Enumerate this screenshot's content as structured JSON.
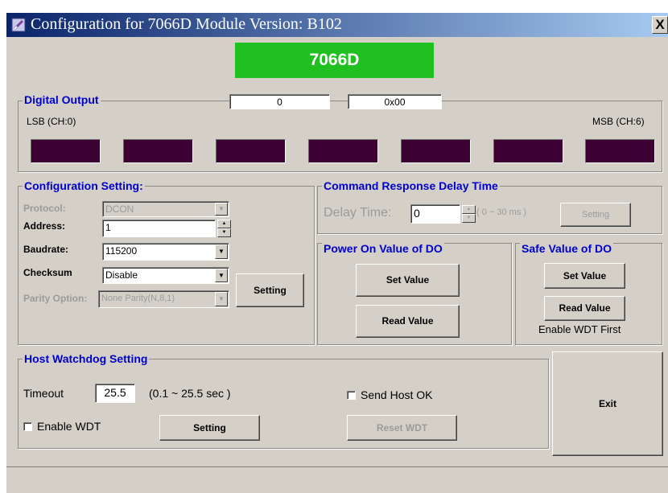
{
  "window": {
    "title": "Configuration for 7066D Module Version: B102",
    "close_label": "X"
  },
  "module_name": "7066D",
  "digital_output": {
    "legend": "Digital Output",
    "decimal_value": "0",
    "hex_value": "0x00",
    "lsb_label": "LSB (CH:0)",
    "msb_label": "MSB (CH:6)",
    "channels": 7
  },
  "config_setting": {
    "legend": "Configuration Setting:",
    "protocol_label": "Protocol:",
    "protocol_value": "DCON",
    "address_label": "Address:",
    "address_value": "1",
    "baudrate_label": "Baudrate:",
    "baudrate_value": "115200",
    "checksum_label": "Checksum",
    "checksum_value": "Disable",
    "parity_label": "Parity Option:",
    "parity_value": "None Parity(N,8,1)",
    "setting_button": "Setting"
  },
  "command_delay": {
    "legend": "Command Response Delay Time",
    "delay_label": "Delay Time:",
    "delay_value": "0",
    "range_text": "( 0 ~ 30 ms )",
    "setting_button": "Setting"
  },
  "power_on_do": {
    "legend": "Power On Value of DO",
    "set_button": "Set Value",
    "read_button": "Read Value"
  },
  "safe_do": {
    "legend": "Safe Value of DO",
    "set_button": "Set Value",
    "read_button": "Read Value",
    "note": "Enable WDT First"
  },
  "host_watchdog": {
    "legend": "Host Watchdog Setting",
    "timeout_label": "Timeout",
    "timeout_value": "25.5",
    "timeout_range": "(0.1 ~ 25.5 sec )",
    "enable_wdt_label": "Enable WDT",
    "send_host_ok_label": "Send Host OK",
    "setting_button": "Setting",
    "reset_button": "Reset WDT"
  },
  "exit_button": "Exit",
  "colors": {
    "banner_bg": "#20c020",
    "led_off": "#3c0032",
    "legend_text": "#0000cc",
    "titlebar_start": "#0a246a",
    "titlebar_end": "#a6caf0"
  },
  "icons": {
    "app": "app-icon",
    "close": "close-icon"
  }
}
